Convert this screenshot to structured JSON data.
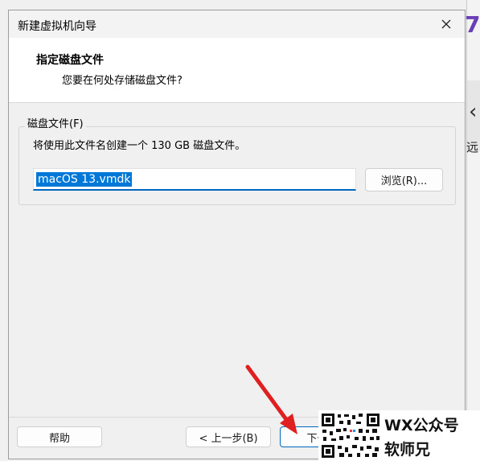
{
  "background": {
    "version_glyph": "7",
    "partial_char": "远"
  },
  "dialog": {
    "title": "新建虚拟机向导",
    "header": {
      "title": "指定磁盘文件",
      "subtitle": "您要在何处存储磁盘文件?"
    },
    "disk_group": {
      "legend": "磁盘文件(F)",
      "description": "将使用此文件名创建一个 130 GB 磁盘文件。",
      "filename_value": "macOS 13.vmdk",
      "browse_label": "浏览(R)..."
    },
    "footer": {
      "help_label": "帮助",
      "back_label": "< 上一步(B)",
      "next_label": "下一步"
    }
  },
  "watermark": {
    "line1": "WX公众号",
    "line2": "软师兄"
  },
  "colors": {
    "accent": "#0067c0",
    "selection": "#0078d7",
    "annotation_arrow": "#e02020",
    "brand_purple": "#6a3fb5"
  }
}
